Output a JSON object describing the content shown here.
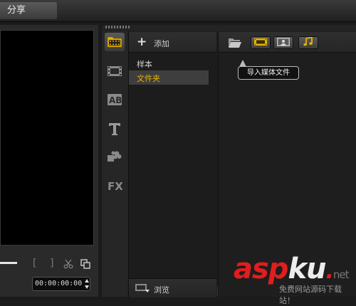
{
  "header": {
    "tab_label": "分享"
  },
  "preview": {
    "timecode": "00:00:00:00"
  },
  "library": {
    "side_tools": [
      {
        "name": "media",
        "icon": "film-folder-icon"
      },
      {
        "name": "instant-project",
        "icon": "film-strip-icon"
      },
      {
        "name": "transition",
        "icon": "ab-transition-icon"
      },
      {
        "name": "title",
        "icon": "title-t-icon"
      },
      {
        "name": "graphics",
        "icon": "graphics-icon"
      },
      {
        "name": "filter",
        "icon": "fx-icon"
      }
    ],
    "add_label": "添加",
    "folders": [
      {
        "label": "样本"
      },
      {
        "label": "文件夹",
        "selected": true
      }
    ],
    "browse_label": "浏览",
    "collapse_symbol": "«",
    "tooltip": "导入媒体文件"
  },
  "watermark": {
    "logo_main": "asp",
    "logo_accent": "ku",
    "logo_dot": ".",
    "logo_tld": "net",
    "subtitle": "免费网站源码下载站！"
  },
  "colors": {
    "accent": "#e6b400",
    "watermark_red": "#e21d1d"
  }
}
